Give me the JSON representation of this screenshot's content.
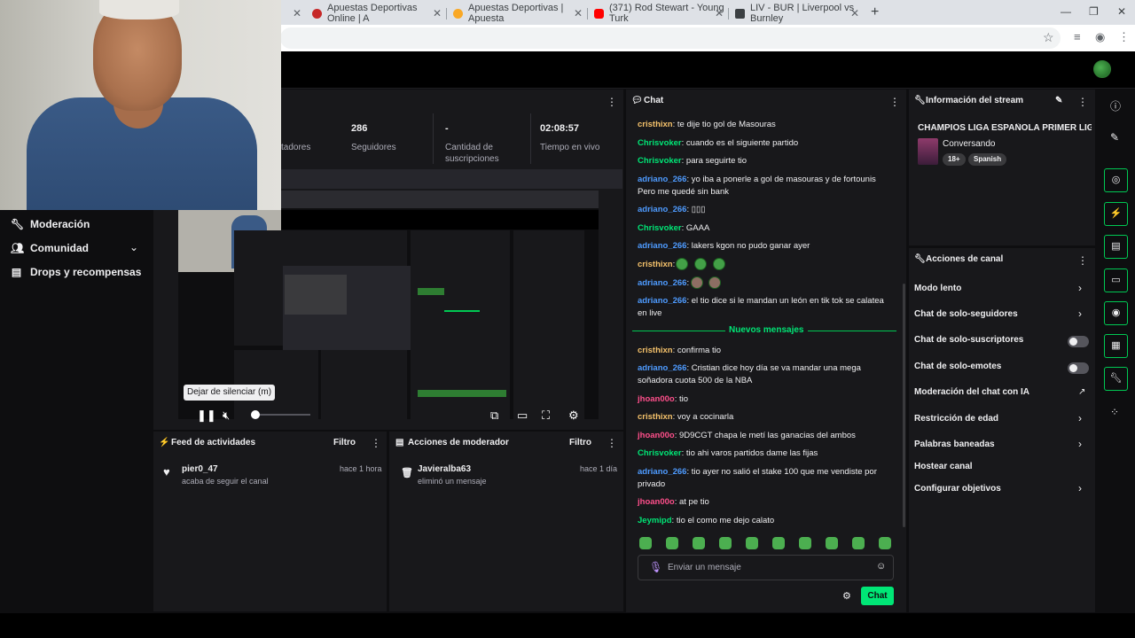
{
  "browser": {
    "tabs": [
      {
        "title": "Apuestas Deportivas Online | A",
        "color": "#c62828"
      },
      {
        "title": "Apuestas Deportivas | Apuesta",
        "color": "#f9a825"
      },
      {
        "title": "(371) Rod Stewart - Young Turk",
        "color": "#ff0000"
      },
      {
        "title": "LIV - BUR | Liverpool vs Burnley",
        "color": "#3c4043"
      }
    ],
    "new_tab": "+",
    "minimize": "—",
    "restore": "❐",
    "close": "✕"
  },
  "sidebar": {
    "items": [
      {
        "label": "Moderación",
        "icon": "wrench-icon"
      },
      {
        "label": "Comunidad",
        "icon": "people-icon"
      },
      {
        "label": "Drops y recompensas",
        "icon": "gift-icon"
      }
    ]
  },
  "stats": [
    {
      "value": "",
      "label": "tadores"
    },
    {
      "value": "286",
      "label": "Seguidores"
    },
    {
      "value": "-",
      "label": "Cantidad de suscripciones"
    },
    {
      "value": "02:08:57",
      "label": "Tiempo en vivo"
    }
  ],
  "player": {
    "tooltip": "Dejar de silenciar (m)"
  },
  "feed": {
    "title": "Feed de actividades",
    "filter": "Filtro",
    "name": "pier0_47",
    "sub": "acaba de seguir el canal",
    "time": "hace 1 hora"
  },
  "mod_actions": {
    "title": "Acciones de moderador",
    "filter": "Filtro",
    "name": "Javieralba63",
    "sub": "eliminó un mensaje",
    "time": "hace 1 día"
  },
  "chat": {
    "title": "Chat",
    "new_messages": "Nuevos mensajes",
    "messages_before": [
      {
        "user": "cristhixn",
        "color": "#f5c26b",
        "text": ": te dije tio gol de Masouras"
      },
      {
        "user": "Chrisvoker",
        "color": "#00e676",
        "text": ": cuando es el siguiente partido"
      },
      {
        "user": "Chrisvoker",
        "color": "#00e676",
        "text": ": para seguirte tio"
      },
      {
        "user": "adriano_266",
        "color": "#4e9bff",
        "text": ": yo iba a ponerle a gol de masouras y de fortounis Pero me quedé sin bank"
      },
      {
        "user": "adriano_266",
        "color": "#4e9bff",
        "text": ": ▯▯▯"
      },
      {
        "user": "Chrisvoker",
        "color": "#00e676",
        "text": ": GAAA"
      },
      {
        "user": "adriano_266",
        "color": "#4e9bff",
        "text": ": lakers kgon no pudo ganar ayer"
      },
      {
        "user": "cristhixn",
        "color": "#f5c26b",
        "text": ":"
      },
      {
        "user": "adriano_266",
        "color": "#4e9bff",
        "text": ":"
      },
      {
        "user": "adriano_266",
        "color": "#4e9bff",
        "text": ": el tio dice si le mandan un león en tik tok se calatea en live"
      }
    ],
    "messages_after": [
      {
        "user": "cristhixn",
        "color": "#f5c26b",
        "text": ": confirma tio"
      },
      {
        "user": "adriano_266",
        "color": "#4e9bff",
        "text": ": Cristian dice hoy día se va mandar una mega soñadora cuota 500 de la NBA"
      },
      {
        "user": "jhoan00o",
        "color": "#ff4f8b",
        "text": ": tio"
      },
      {
        "user": "cristhixn",
        "color": "#f5c26b",
        "text": ": voy a cocinarla"
      },
      {
        "user": "jhoan00o",
        "color": "#ff4f8b",
        "text": ": 9D9CGT chapa le metí las ganacias del ambos"
      },
      {
        "user": "Chrisvoker",
        "color": "#00e676",
        "text": ": tio ahi varos partidos dame las fijas"
      },
      {
        "user": "adriano_266",
        "color": "#4e9bff",
        "text": ": tio ayer no salió el stake 100 que me vendiste por privado"
      },
      {
        "user": "jhoan00o",
        "color": "#ff4f8b",
        "text": ": at pe tio"
      },
      {
        "user": "Jeymipd",
        "color": "#00e676",
        "text": ": tio el como me dejo calato"
      }
    ],
    "input_placeholder": "Enviar un mensaje",
    "send_label": "Chat"
  },
  "stream_info": {
    "header": "Información del stream",
    "title": "CHAMPIOS LIGA ESPAÑOLA PRIMER LIGE",
    "category": "Conversando",
    "tags": [
      "18+",
      "Spanish"
    ]
  },
  "channel_actions": {
    "header": "Acciones de canal",
    "items": [
      {
        "label": "Modo lento",
        "kind": "chevron"
      },
      {
        "label": "Chat de solo-seguidores",
        "kind": "chevron"
      },
      {
        "label": "Chat de solo-suscriptores",
        "kind": "toggle"
      },
      {
        "label": "Chat de solo-emotes",
        "kind": "toggle"
      },
      {
        "label": "Moderación del chat con IA",
        "kind": "external"
      },
      {
        "label": "Restricción de edad",
        "kind": "chevron"
      },
      {
        "label": "Palabras baneadas",
        "kind": "chevron"
      },
      {
        "label": "Hostear canal",
        "kind": "none"
      },
      {
        "label": "Configurar objetivos",
        "kind": "chevron"
      }
    ]
  }
}
